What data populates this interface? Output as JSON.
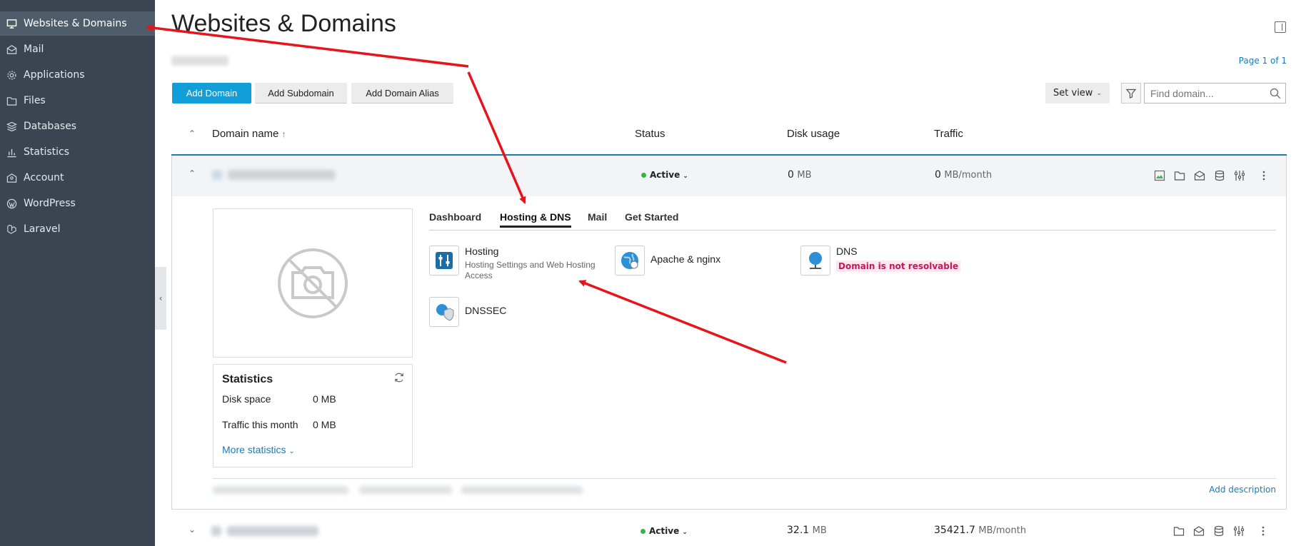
{
  "sidebar": {
    "items": [
      {
        "label": "Websites & Domains",
        "icon": "monitor-icon",
        "active": true
      },
      {
        "label": "Mail",
        "icon": "envelope-icon"
      },
      {
        "label": "Applications",
        "icon": "gear-icon"
      },
      {
        "label": "Files",
        "icon": "folder-icon"
      },
      {
        "label": "Databases",
        "icon": "layers-icon"
      },
      {
        "label": "Statistics",
        "icon": "bar-chart-icon"
      },
      {
        "label": "Account",
        "icon": "account-icon"
      },
      {
        "label": "WordPress",
        "icon": "wordpress-icon"
      },
      {
        "label": "Laravel",
        "icon": "laravel-icon"
      }
    ]
  },
  "header": {
    "title": "Websites & Domains",
    "page_info": "Page 1 of 1"
  },
  "toolbar": {
    "add_domain": "Add Domain",
    "add_subdomain": "Add Subdomain",
    "add_alias": "Add Domain Alias",
    "set_view": "Set view",
    "search_placeholder": "Find domain..."
  },
  "table": {
    "columns": {
      "domain": "Domain name",
      "sort_indicator": "↑",
      "status": "Status",
      "disk": "Disk usage",
      "traffic": "Traffic"
    },
    "rows": [
      {
        "status": "Active",
        "disk_value": "0",
        "disk_unit": "MB",
        "traffic_value": "0",
        "traffic_unit": "MB/month"
      },
      {
        "status": "Active",
        "disk_value": "32.1",
        "disk_unit": "MB",
        "traffic_value": "35421.7",
        "traffic_unit": "MB/month"
      }
    ]
  },
  "expanded": {
    "tabs": [
      "Dashboard",
      "Hosting & DNS",
      "Mail",
      "Get Started"
    ],
    "active_tab": "Hosting & DNS",
    "tools": {
      "hosting": {
        "name": "Hosting",
        "desc": "Hosting Settings and Web Hosting Access"
      },
      "apache": {
        "name": "Apache & nginx"
      },
      "dns": {
        "name": "DNS",
        "warning": "Domain is not resolvable"
      },
      "dnssec": {
        "name": "DNSSEC"
      }
    },
    "stats": {
      "title": "Statistics",
      "disk_label": "Disk space",
      "disk_value": "0 MB",
      "traffic_label": "Traffic this month",
      "traffic_value": "0 MB",
      "more": "More statistics"
    },
    "add_description": "Add description"
  },
  "colors": {
    "sidebar_bg": "#3a4551",
    "accent": "#119ed9",
    "link": "#1d7bb3",
    "annotation_arrow": "#e8141b"
  }
}
